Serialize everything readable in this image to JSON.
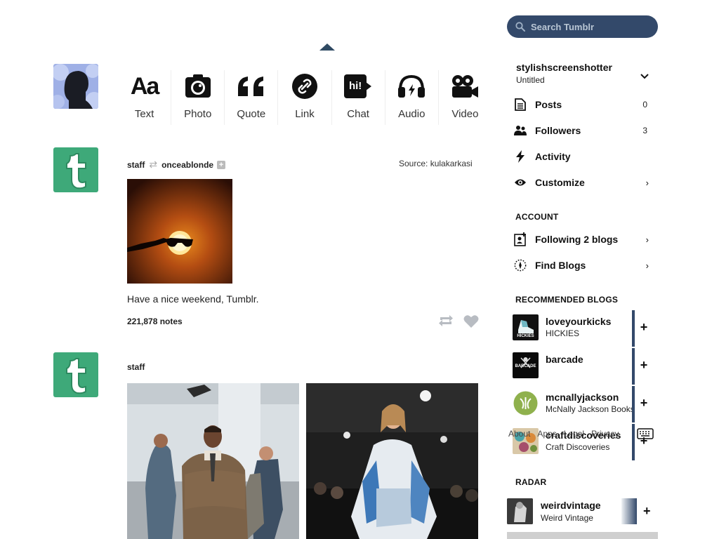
{
  "post_types": [
    {
      "label": "Text",
      "icon": "text-icon"
    },
    {
      "label": "Photo",
      "icon": "camera-icon"
    },
    {
      "label": "Quote",
      "icon": "quote-icon"
    },
    {
      "label": "Link",
      "icon": "link-icon"
    },
    {
      "label": "Chat",
      "icon": "chat-icon",
      "badge": "hi!"
    },
    {
      "label": "Audio",
      "icon": "headphones-icon"
    },
    {
      "label": "Video",
      "icon": "video-camera-icon"
    }
  ],
  "posts": [
    {
      "author": "staff",
      "reblogged_from": "onceablonde",
      "source_label": "Source:",
      "source": "kulakarkasi",
      "caption": "Have a nice weekend, Tumblr.",
      "notes": "221,878 notes"
    },
    {
      "author": "staff"
    }
  ],
  "search": {
    "placeholder": "Search Tumblr"
  },
  "blog": {
    "name": "stylishscreenshotter",
    "title": "Untitled"
  },
  "menu": [
    {
      "label": "Posts",
      "count": "0",
      "icon": "document-icon"
    },
    {
      "label": "Followers",
      "count": "3",
      "icon": "people-icon"
    },
    {
      "label": "Activity",
      "icon": "bolt-icon"
    },
    {
      "label": "Customize",
      "icon": "eye-icon"
    }
  ],
  "account": {
    "title": "ACCOUNT",
    "items": [
      {
        "label": "Following 2 blogs",
        "icon": "add-person-icon"
      },
      {
        "label": "Find Blogs",
        "icon": "compass-icon"
      }
    ]
  },
  "recommended": {
    "title": "RECOMMENDED BLOGS",
    "items": [
      {
        "name": "loveyourkicks",
        "subtitle": "HICKIES",
        "thumb_text": "HICKIES"
      },
      {
        "name": "barcade",
        "subtitle": "",
        "thumb_text": "BARCADE"
      },
      {
        "name": "mcnallyjackson",
        "subtitle": "McNally Jackson Books"
      },
      {
        "name": "craftdiscoveries",
        "subtitle": "Craft Discoveries"
      }
    ]
  },
  "overlay_links": [
    "About",
    "Apps",
    "Legal",
    "Privacy"
  ],
  "radar": {
    "title": "RADAR",
    "name": "weirdvintage",
    "subtitle": "Weird Vintage"
  },
  "colors": {
    "navy": "#33496a",
    "tumblr_green": "#3ea979"
  }
}
